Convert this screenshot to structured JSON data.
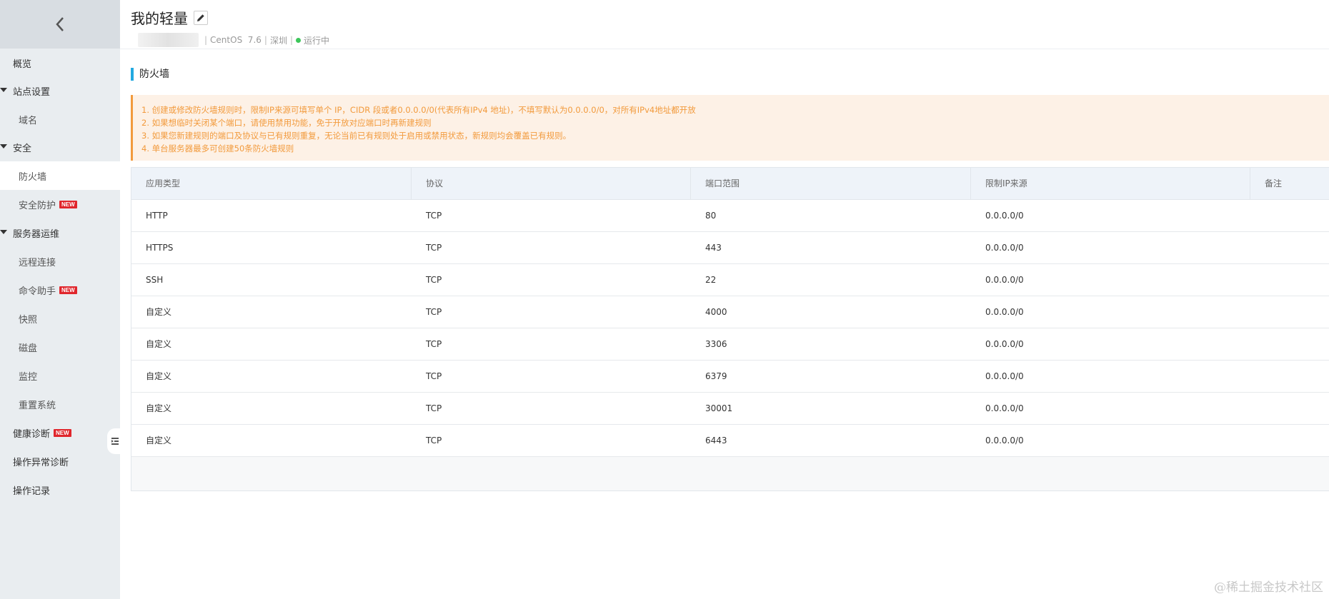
{
  "sidebar": {
    "back_icon": "chevron-left-icon",
    "items": [
      {
        "label": "概览",
        "level": "top",
        "caret": false,
        "badge": ""
      },
      {
        "label": "站点设置",
        "level": "top",
        "caret": true,
        "badge": ""
      },
      {
        "label": "域名",
        "level": "sub",
        "caret": false,
        "badge": ""
      },
      {
        "label": "安全",
        "level": "top",
        "caret": true,
        "badge": ""
      },
      {
        "label": "防火墙",
        "level": "sub",
        "caret": false,
        "badge": "",
        "active": true
      },
      {
        "label": "安全防护",
        "level": "sub",
        "caret": false,
        "badge": "NEW"
      },
      {
        "label": "服务器运维",
        "level": "top",
        "caret": true,
        "badge": ""
      },
      {
        "label": "远程连接",
        "level": "sub",
        "caret": false,
        "badge": ""
      },
      {
        "label": "命令助手",
        "level": "sub",
        "caret": false,
        "badge": "NEW"
      },
      {
        "label": "快照",
        "level": "sub",
        "caret": false,
        "badge": ""
      },
      {
        "label": "磁盘",
        "level": "sub",
        "caret": false,
        "badge": ""
      },
      {
        "label": "监控",
        "level": "sub",
        "caret": false,
        "badge": ""
      },
      {
        "label": "重置系统",
        "level": "sub",
        "caret": false,
        "badge": ""
      },
      {
        "label": "健康诊断",
        "level": "top",
        "caret": false,
        "badge": "NEW"
      },
      {
        "label": "操作异常诊断",
        "level": "top",
        "caret": false,
        "badge": ""
      },
      {
        "label": "操作记录",
        "level": "top",
        "caret": false,
        "badge": ""
      }
    ]
  },
  "header": {
    "title": "我的轻量",
    "os": "CentOS  7.6",
    "region": "深圳",
    "status": "运行中",
    "status_color": "#3cc65a"
  },
  "section": {
    "title": "防火墙",
    "accent_color": "#22a9e0"
  },
  "notice": {
    "lines": [
      "1. 创建或修改防火墙规则时，限制IP来源可填写单个 IP，CIDR 段或者0.0.0.0/0(代表所有IPv4 地址)，不填写默认为0.0.0.0/0，对所有IPv4地址都开放",
      "2. 如果想临时关闭某个端口，请使用禁用功能，免于开放对应端口时再新建规则",
      "3. 如果您新建规则的端口及协议与已有规则重复，无论当前已有规则处于启用或禁用状态，新规则均会覆盖已有规则。",
      "4. 单台服务器最多可创建50条防火墙规则"
    ],
    "color": "#f29a3c"
  },
  "table": {
    "headers": [
      "应用类型",
      "协议",
      "端口范围",
      "限制IP来源",
      "备注"
    ],
    "rows": [
      [
        "HTTP",
        "TCP",
        "80",
        "0.0.0.0/0",
        ""
      ],
      [
        "HTTPS",
        "TCP",
        "443",
        "0.0.0.0/0",
        ""
      ],
      [
        "SSH",
        "TCP",
        "22",
        "0.0.0.0/0",
        ""
      ],
      [
        "自定义",
        "TCP",
        "4000",
        "0.0.0.0/0",
        ""
      ],
      [
        "自定义",
        "TCP",
        "3306",
        "0.0.0.0/0",
        ""
      ],
      [
        "自定义",
        "TCP",
        "6379",
        "0.0.0.0/0",
        ""
      ],
      [
        "自定义",
        "TCP",
        "30001",
        "0.0.0.0/0",
        ""
      ],
      [
        "自定义",
        "TCP",
        "6443",
        "0.0.0.0/0",
        ""
      ]
    ]
  },
  "watermark": "@稀土掘金技术社区"
}
